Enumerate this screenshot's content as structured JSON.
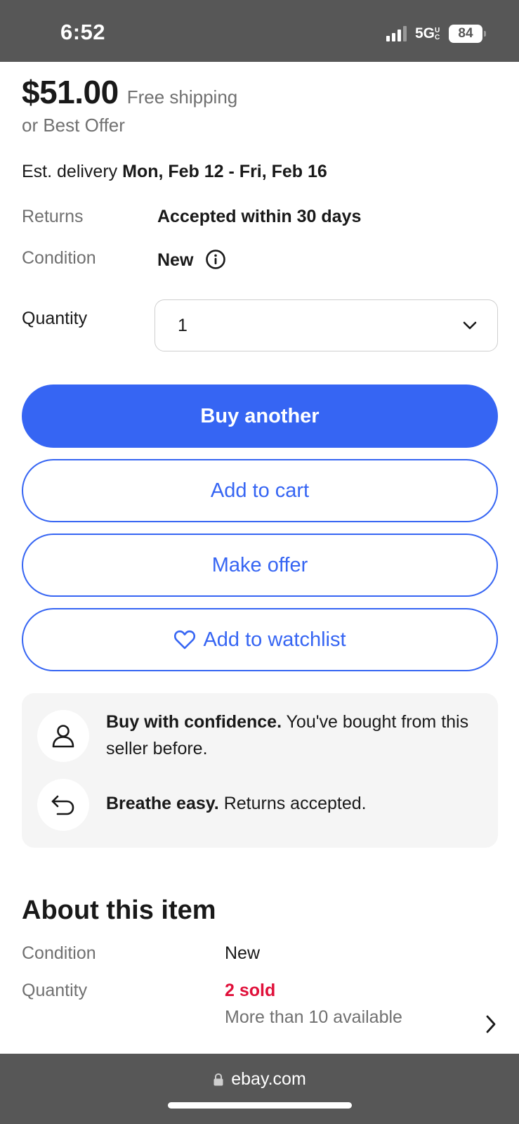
{
  "status_bar": {
    "time": "6:52",
    "network": "5G",
    "network_suffix": "UC",
    "battery": "84"
  },
  "listing": {
    "price": "$51.00",
    "shipping": "Free shipping",
    "best_offer": "or Best Offer",
    "delivery_label": "Est. delivery",
    "delivery_dates": "Mon, Feb 12 - Fri, Feb 16",
    "returns_label": "Returns",
    "returns_value": "Accepted within 30 days",
    "condition_label": "Condition",
    "condition_value": "New",
    "quantity_label": "Quantity",
    "quantity_value": "1"
  },
  "actions": {
    "buy_another": "Buy another",
    "add_to_cart": "Add to cart",
    "make_offer": "Make offer",
    "add_to_watchlist": "Add to watchlist"
  },
  "confidence": {
    "buy_title": "Buy with confidence.",
    "buy_text": "You've bought from this seller before.",
    "breathe_title": "Breathe easy.",
    "breathe_text": "Returns accepted."
  },
  "about": {
    "title": "About this item",
    "condition_label": "Condition",
    "condition_value": "New",
    "quantity_label": "Quantity",
    "sold": "2 sold",
    "available": "More than 10 available"
  },
  "browser": {
    "url": "ebay.com"
  },
  "colors": {
    "primary": "#3665f3",
    "sold_red": "#e0103a",
    "muted_text": "#707070"
  }
}
